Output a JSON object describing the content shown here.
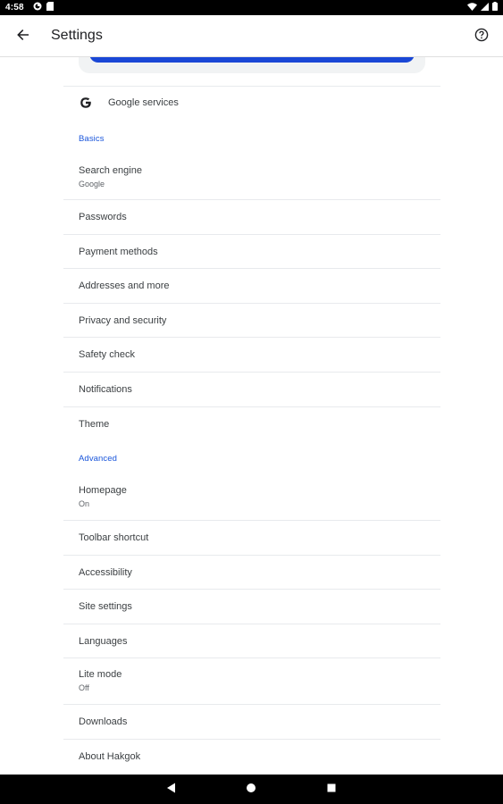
{
  "status_bar": {
    "time": "4:58",
    "icons": [
      "notification-circle-icon",
      "sd-card-icon",
      "wifi-icon",
      "signal-icon",
      "battery-icon"
    ]
  },
  "app_bar": {
    "title": "Settings",
    "back_icon": "arrow-back-icon",
    "help_icon": "help-circle-icon"
  },
  "google_services": {
    "label": "Google services",
    "icon": "google-g-icon"
  },
  "sections": {
    "basics": "Basics",
    "advanced": "Advanced"
  },
  "items": {
    "search_engine": {
      "title": "Search engine",
      "subtitle": "Google"
    },
    "passwords": {
      "title": "Passwords"
    },
    "payment_methods": {
      "title": "Payment methods"
    },
    "addresses": {
      "title": "Addresses and more"
    },
    "privacy": {
      "title": "Privacy and security"
    },
    "safety_check": {
      "title": "Safety check"
    },
    "notifications": {
      "title": "Notifications"
    },
    "theme": {
      "title": "Theme"
    },
    "homepage": {
      "title": "Homepage",
      "subtitle": "On"
    },
    "toolbar_shortcut": {
      "title": "Toolbar shortcut"
    },
    "accessibility": {
      "title": "Accessibility"
    },
    "site_settings": {
      "title": "Site settings"
    },
    "languages": {
      "title": "Languages"
    },
    "lite_mode": {
      "title": "Lite mode",
      "subtitle": "Off"
    },
    "downloads": {
      "title": "Downloads"
    },
    "about": {
      "title": "About Hakgok"
    }
  },
  "colors": {
    "accent": "#1a56db",
    "button_blue": "#1a47d6",
    "divider": "#e8eaed"
  },
  "nav_bar": {
    "icons": [
      "back-triangle-icon",
      "home-circle-icon",
      "recents-square-icon"
    ]
  }
}
